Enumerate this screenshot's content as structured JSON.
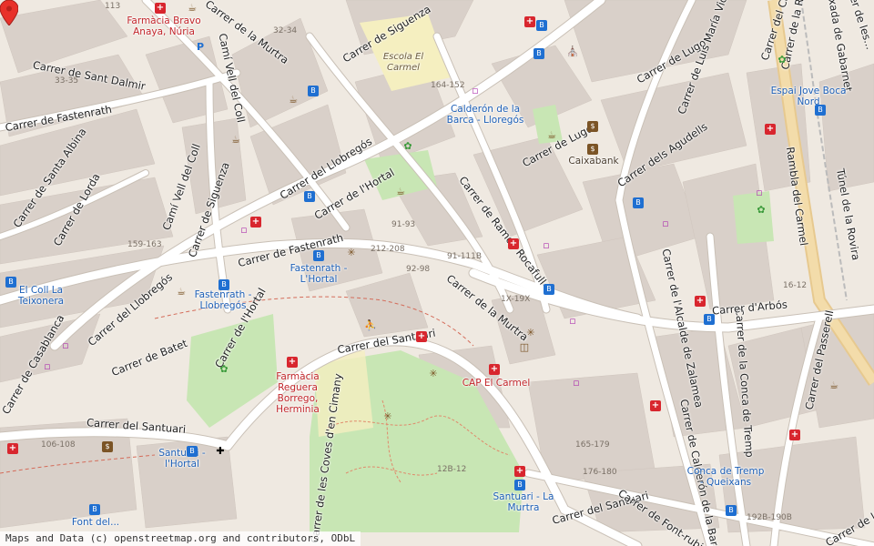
{
  "attribution": "Maps and Data (c) openstreetmap.org and contributors, ODbL",
  "colors": {
    "background": "#efe9e1",
    "buildings": "#d9d0c9",
    "road_major": "#ffffff",
    "road_casing": "#c9c0b6",
    "park": "#c8e6b4",
    "school": "#f5efc0",
    "rail": "#e7c98f",
    "marker": "#e8312a"
  },
  "streets": [
    {
      "name": "Carrer de Siguenza",
      "key": "siguenza1"
    },
    {
      "name": "Carrer de la Murtra",
      "key": "murtra1"
    },
    {
      "name": "Carrer de Sant Dalmir",
      "key": "santdalmir"
    },
    {
      "name": "Camí Vell del Coll",
      "key": "camivell1"
    },
    {
      "name": "Camí Vell del Coll",
      "key": "camivell2"
    },
    {
      "name": "Carrer de Siguenza",
      "key": "siguenza2"
    },
    {
      "name": "Carrer del Llobregós",
      "key": "llobregos1"
    },
    {
      "name": "Carrer de l'Hortal",
      "key": "hortal1"
    },
    {
      "name": "Carrer de Fastenrath",
      "key": "fastenrath1"
    },
    {
      "name": "Carrer de Fastenrath",
      "key": "fastenrath2"
    },
    {
      "name": "Carrer de Lorda",
      "key": "lorda"
    },
    {
      "name": "Carrer de Santa Albina",
      "key": "santaalbina"
    },
    {
      "name": "Carrer del Llobregós",
      "key": "llobregos2"
    },
    {
      "name": "Carrer de l'Hortal",
      "key": "hortal2"
    },
    {
      "name": "Carrer de Batet",
      "key": "batet"
    },
    {
      "name": "Carrer de Casablanca",
      "key": "casablanca"
    },
    {
      "name": "Carrer del Santuari",
      "key": "santuari1"
    },
    {
      "name": "Carrer del Santuari",
      "key": "santuari2"
    },
    {
      "name": "Carrer de les Coves d'en Cimany",
      "key": "coves"
    },
    {
      "name": "Carrer de Ramon Rocafull",
      "key": "rocafull"
    },
    {
      "name": "Carrer de la Murtra",
      "key": "murtra2"
    },
    {
      "name": "Carrer de Lugo",
      "key": "lugo1"
    },
    {
      "name": "Carrer de Lugo",
      "key": "lugo2"
    },
    {
      "name": "Carrer de Luis María Vidal",
      "key": "vidal"
    },
    {
      "name": "Carrer del Carmel",
      "key": "carmel"
    },
    {
      "name": "Carrer dels Agudells",
      "key": "agudells"
    },
    {
      "name": "Carrer de l'Alcalde de Zalamea",
      "key": "zalamea"
    },
    {
      "name": "Carrer de la Conca de Tremp",
      "key": "concatremp"
    },
    {
      "name": "Carrer de Calderón de la Barca",
      "key": "calderon"
    },
    {
      "name": "Carrer d'Arbós",
      "key": "arbos"
    },
    {
      "name": "Carrer del Passerell",
      "key": "passerell"
    },
    {
      "name": "Rambla del Carmel",
      "key": "rambla"
    },
    {
      "name": "Túnel de la Rovira",
      "key": "tunel"
    },
    {
      "name": "Carrer del Santuari",
      "key": "santuari3"
    },
    {
      "name": "Carrer de Font-rubia",
      "key": "fontrubia"
    },
    {
      "name": "Carrer de la Gran Via",
      "key": "granvia"
    },
    {
      "name": "Carrer de la Rovira",
      "key": "rovira"
    },
    {
      "name": "Baixada de Gabarnet",
      "key": "gabarnet"
    },
    {
      "name": "Carrer de les...",
      "key": "cies"
    }
  ],
  "pois": {
    "farmacia_bravo": "Farmàcia Bravo Anaya, Núria",
    "escola_carmel": "Escola El Carmel",
    "calderon_lloregos": "Calderón de la Barca - Lloregós",
    "caixabank": "Caixabank",
    "espai_jove": "Espai Jove Boca Nord",
    "el_coll": "El Coll La Teixonera",
    "fastenrath_hortal": "Fastenrath - L'Hortal",
    "fastenrath_llobregos": "Fastenrath - Llobregós",
    "farmacia_reguera": "Farmàcia Reguera Borrego, Herminia",
    "cap_carmel": "CAP El Carmel",
    "santuari_hortal": "Santuari - l'Hortal",
    "santuari_murtra": "Santuari - La Murtra",
    "conca_tremp": "Conca de Tremp - Queixans",
    "font_del": "Font del..."
  },
  "marker_label": "location-pin"
}
